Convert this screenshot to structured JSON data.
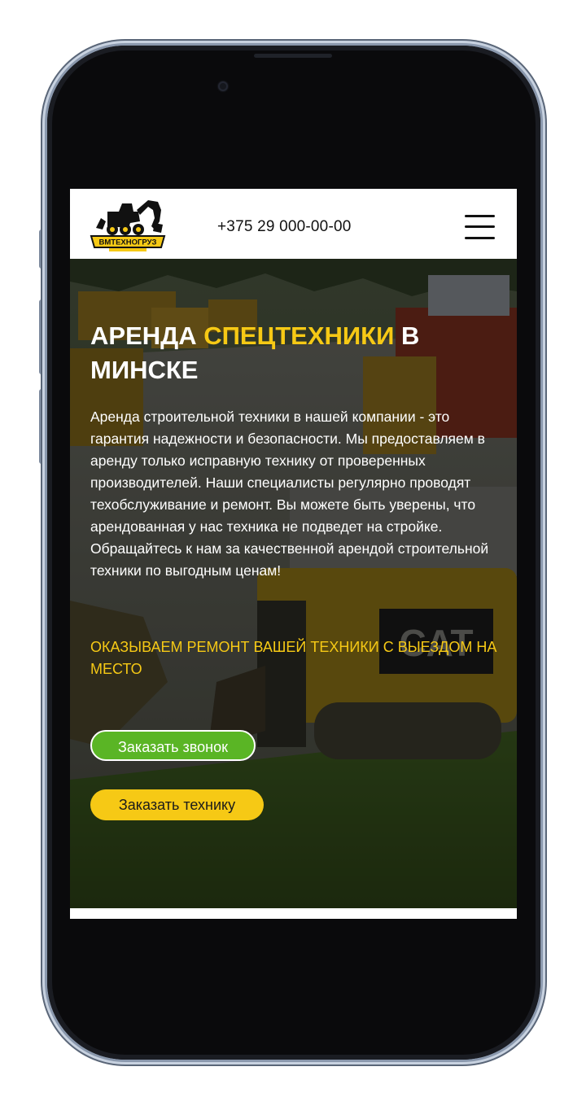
{
  "header": {
    "logo_text": "ВМТЕХНОГРУЗ",
    "phone": "+375 29 000-00-00",
    "menu_icon": "burger-menu-icon"
  },
  "hero": {
    "title_part1": "Аренда ",
    "title_highlight": "спецтехники",
    "title_part2": " в Минске",
    "description": "Аренда строительной техники в нашей компании - это гарантия надежности и безопасности. Мы предоставляем в аренду только исправную технику от проверенных производителей. Наши специалисты регулярно проводят техобслуживание и ремонт. Вы можете быть уверены, что арендованная у нас техника не подведет на стройке. Обращайтесь к нам за качественной арендой строительной техники по выгодным ценам!",
    "service_note": "Оказываем ремонт вашей техники с выездом на место",
    "btn_call": "Заказать звонок",
    "btn_order": "Заказать технику",
    "bg_brand": "CAT"
  },
  "colors": {
    "accent_yellow": "#f6c915",
    "accent_green": "#5ab525",
    "phone_frame": "#c8d2e0"
  }
}
